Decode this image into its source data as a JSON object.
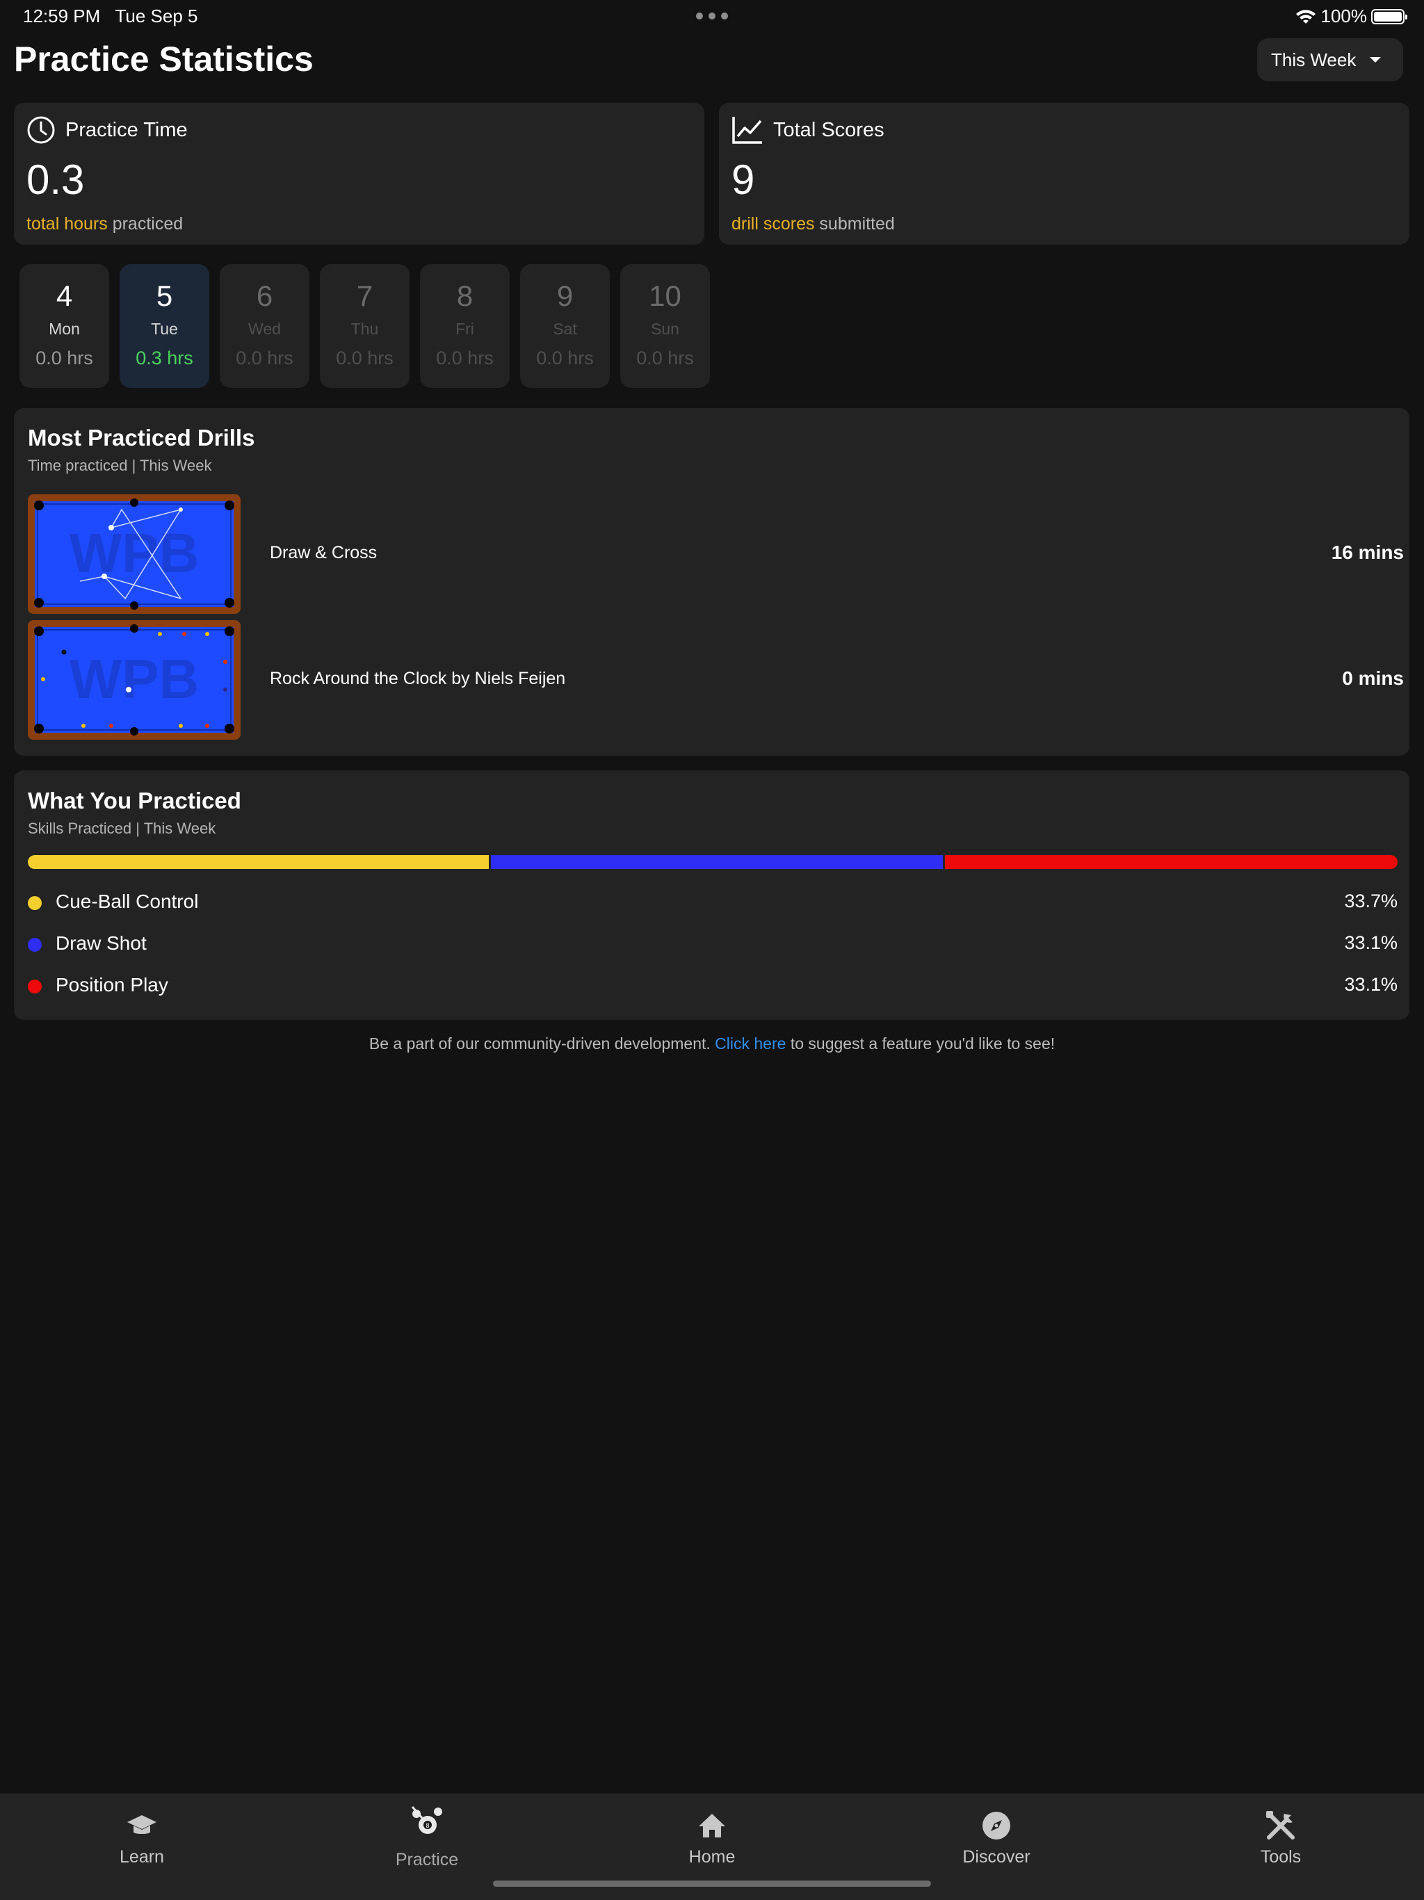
{
  "status_bar": {
    "time": "12:59 PM",
    "date": "Tue Sep 5",
    "battery": "100%"
  },
  "header": {
    "title": "Practice Statistics",
    "period": "This Week"
  },
  "summary": {
    "practice_time": {
      "title": "Practice Time",
      "value": "0.3",
      "accent": "total hours",
      "suffix": " practiced",
      "icon": "clock-icon"
    },
    "total_scores": {
      "title": "Total Scores",
      "value": "9",
      "accent": "drill scores",
      "suffix": " submitted",
      "icon": "line-chart-icon"
    }
  },
  "days": [
    {
      "num": "4",
      "name": "Mon",
      "hrs": "0.0 hrs"
    },
    {
      "num": "5",
      "name": "Tue",
      "hrs": "0.3 hrs"
    },
    {
      "num": "6",
      "name": "Wed",
      "hrs": "0.0 hrs"
    },
    {
      "num": "7",
      "name": "Thu",
      "hrs": "0.0 hrs"
    },
    {
      "num": "8",
      "name": "Fri",
      "hrs": "0.0 hrs"
    },
    {
      "num": "9",
      "name": "Sat",
      "hrs": "0.0 hrs"
    },
    {
      "num": "10",
      "name": "Sun",
      "hrs": "0.0 hrs"
    }
  ],
  "drills": {
    "title": "Most Practiced Drills",
    "subtitle": "Time practiced | This Week",
    "items": [
      {
        "name": "Draw & Cross",
        "time": "16 mins"
      },
      {
        "name": "Rock Around the Clock by Niels Feijen",
        "time": "0 mins"
      }
    ]
  },
  "skills": {
    "title": "What You Practiced",
    "subtitle": "Skills Practiced | This Week",
    "items": [
      {
        "label": "Cue-Ball Control",
        "pct": "33.7%",
        "value": 33.7,
        "color": "#f4d02e"
      },
      {
        "label": "Draw Shot",
        "pct": "33.1%",
        "value": 33.1,
        "color": "#2e2ef5"
      },
      {
        "label": "Position Play",
        "pct": "33.1%",
        "value": 33.1,
        "color": "#ee0a0a"
      }
    ]
  },
  "community": {
    "before": "Be a part of our community-driven development. ",
    "link": "Click here",
    "after": " to suggest a feature you'd like to see!"
  },
  "tabs": [
    {
      "label": "Learn",
      "icon": "graduation-cap-icon"
    },
    {
      "label": "Practice",
      "icon": "billiard-balls-icon"
    },
    {
      "label": "Home",
      "icon": "home-icon"
    },
    {
      "label": "Discover",
      "icon": "compass-icon"
    },
    {
      "label": "Tools",
      "icon": "tools-icon"
    }
  ],
  "colors": {
    "background": "#121212",
    "card": "#232323",
    "accent_gold": "#e8b024",
    "active_green": "#4cd45c",
    "link_blue": "#2f8ff0",
    "table_felt": "#1e4bff",
    "table_rail": "#8b3f0f"
  }
}
